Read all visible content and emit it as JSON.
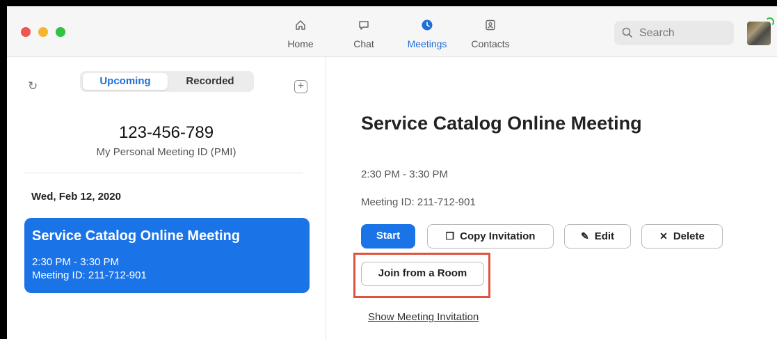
{
  "nav": {
    "tabs": [
      {
        "label": "Home",
        "icon": "home-icon"
      },
      {
        "label": "Chat",
        "icon": "chat-icon"
      },
      {
        "label": "Meetings",
        "icon": "clock-icon",
        "active": true
      },
      {
        "label": "Contacts",
        "icon": "contacts-icon"
      }
    ],
    "search_label": "Search"
  },
  "left": {
    "segments": [
      "Upcoming",
      "Recorded"
    ],
    "pmi_number": "123-456-789",
    "pmi_label": "My Personal Meeting ID (PMI)",
    "date_header": "Wed, Feb 12, 2020",
    "meeting": {
      "title": "Service Catalog Online Meeting",
      "time": "2:30 PM - 3:30 PM",
      "id": "Meeting ID: 211-712-901"
    }
  },
  "detail": {
    "title": "Service Catalog Online Meeting",
    "time": "2:30 PM - 3:30 PM",
    "id": "Meeting ID: 211-712-901",
    "buttons": {
      "start": "Start",
      "copy": "Copy Invitation",
      "edit": "Edit",
      "delete": "Delete",
      "join_room": "Join from a Room"
    },
    "show_invitation": "Show Meeting Invitation"
  },
  "colors": {
    "accent": "#1b73e8",
    "highlight": "#e0533f"
  }
}
